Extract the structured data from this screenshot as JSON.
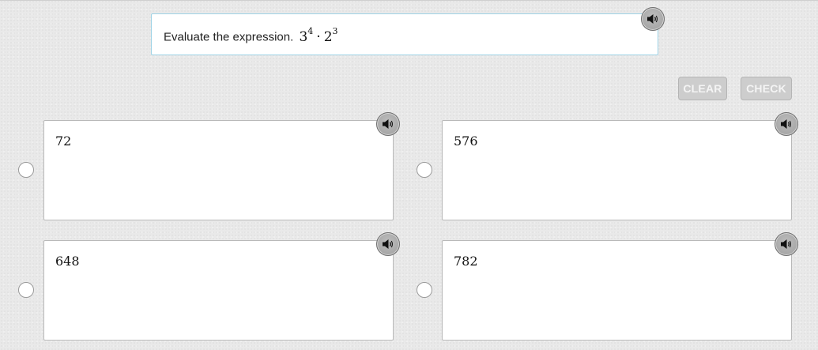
{
  "question": {
    "prompt": "Evaluate the expression.",
    "expression": {
      "base1": "3",
      "exp1": "4",
      "operator": "·",
      "base2": "2",
      "exp2": "3"
    },
    "audio_icon": "speaker-icon"
  },
  "controls": {
    "clear_label": "CLEAR",
    "check_label": "CHECK"
  },
  "choices": [
    {
      "label": "72",
      "selected": false,
      "audio_icon": "speaker-icon"
    },
    {
      "label": "576",
      "selected": false,
      "audio_icon": "speaker-icon"
    },
    {
      "label": "648",
      "selected": false,
      "audio_icon": "speaker-icon"
    },
    {
      "label": "782",
      "selected": false,
      "audio_icon": "speaker-icon"
    }
  ],
  "colors": {
    "background": "#e9e9e9",
    "question_border": "#9fd3e6",
    "button_disabled": "#cdcdcd",
    "audio_button": "#a8a8a8"
  }
}
